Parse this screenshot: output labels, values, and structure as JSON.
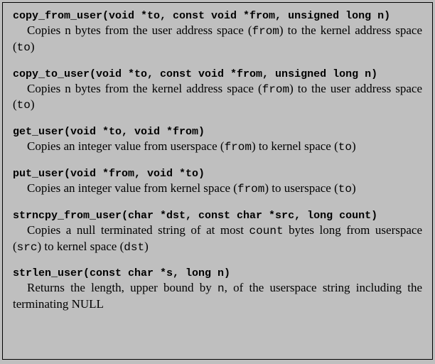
{
  "entries": [
    {
      "sig": "copy_from_user(void *to, const void *from, unsigned long n)",
      "desc_parts": [
        "Copies n bytes from the user address space (",
        "from",
        ") to the kernel address space (",
        "to",
        ")"
      ]
    },
    {
      "sig": "copy_to_user(void *to, const void *from, unsigned long n)",
      "desc_parts": [
        "Copies n bytes from the kernel address space (",
        "from",
        ") to the user address space (",
        "to",
        ")"
      ]
    },
    {
      "sig": "get_user(void *to, void *from)",
      "desc_parts": [
        "Copies an integer value from userspace (",
        "from",
        ") to kernel space (",
        "to",
        ")"
      ]
    },
    {
      "sig": "put_user(void *from, void *to)",
      "desc_parts": [
        "Copies an integer value from kernel space (",
        "from",
        ") to userspace (",
        "to",
        ")"
      ]
    },
    {
      "sig": "strncpy_from_user(char *dst, const char *src, long count)",
      "desc_parts": [
        "Copies a null terminated string of at most ",
        "count",
        " bytes long from userspace (",
        "src",
        ") to kernel space (",
        "dst",
        ")"
      ]
    },
    {
      "sig": "strlen_user(const char *s, long n)",
      "desc_parts": [
        "Returns the length, upper bound by ",
        "n",
        ", of the userspace string including the terminating NULL"
      ]
    }
  ]
}
